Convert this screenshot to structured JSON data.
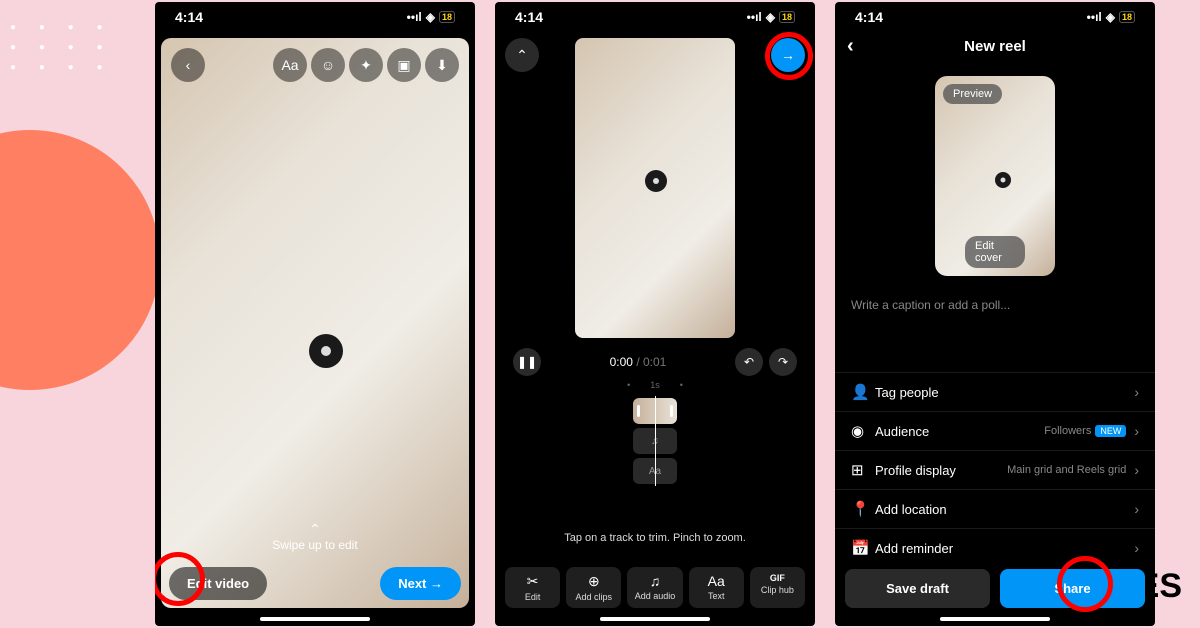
{
  "status": {
    "time": "4:14",
    "battery": "18"
  },
  "phone1": {
    "swipe_label": "Swipe up to edit",
    "edit_label": "Edit video",
    "next_label": "Next →"
  },
  "phone2": {
    "time_current": "0:00",
    "time_sep": " / ",
    "time_total": "0:01",
    "ruler_mark": "1s",
    "hint": "Tap on a track to trim. Pinch to zoom.",
    "tools": [
      {
        "icon": "✂",
        "label": "Edit"
      },
      {
        "icon": "⊕",
        "label": "Add clips"
      },
      {
        "icon": "♫",
        "label": "Add audio"
      },
      {
        "icon": "Aa",
        "label": "Text"
      },
      {
        "icon": "GIF",
        "label": "Clip hub"
      }
    ]
  },
  "phone3": {
    "title": "New reel",
    "preview_label": "Preview",
    "edit_cover_label": "Edit cover",
    "caption_placeholder": "Write a caption or add a poll...",
    "items": [
      {
        "icon": "👤",
        "label": "Tag people",
        "value": ""
      },
      {
        "icon": "◉",
        "label": "Audience",
        "value": "Followers",
        "new": true
      },
      {
        "icon": "⊞",
        "label": "Profile display",
        "value": "Main grid and Reels grid"
      },
      {
        "icon": "📍",
        "label": "Add location",
        "value": ""
      },
      {
        "icon": "📅",
        "label": "Add reminder",
        "value": ""
      }
    ],
    "save_label": "Save draft",
    "share_label": "Share"
  },
  "watermark": "MES"
}
